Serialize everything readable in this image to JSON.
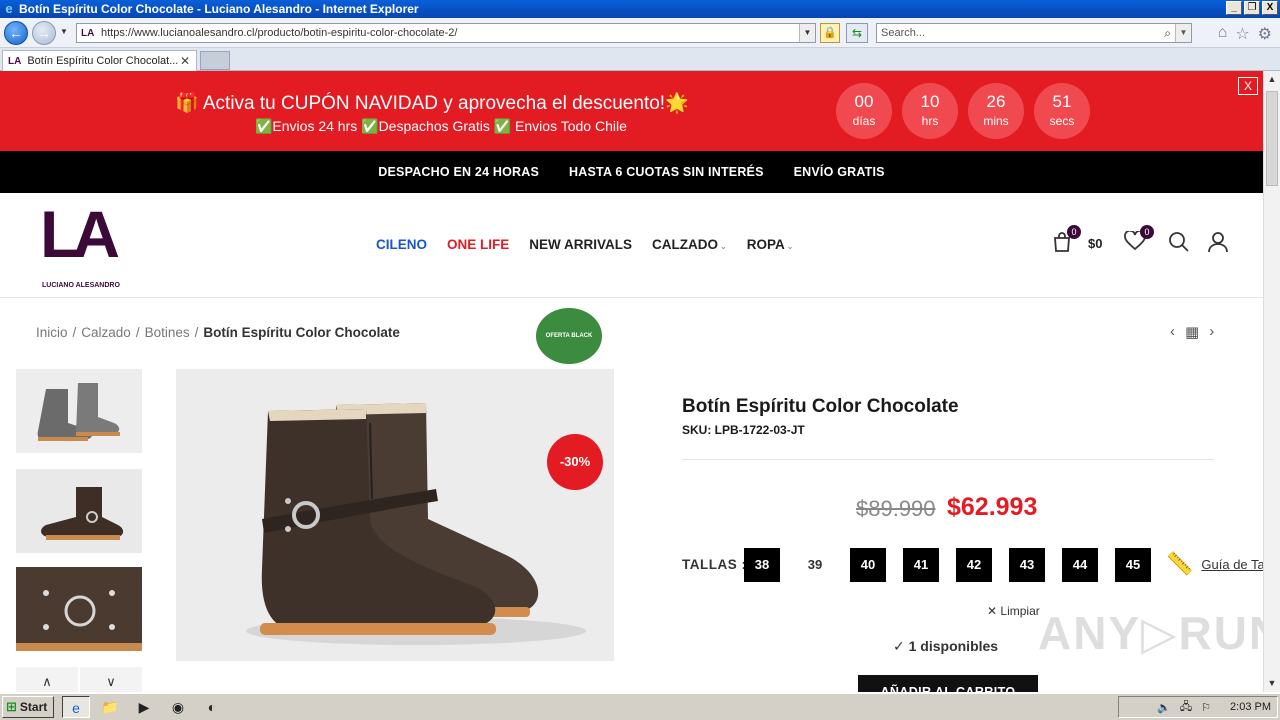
{
  "window": {
    "title": "Botín Espíritu Color Chocolate - Luciano Alesandro - Internet Explorer",
    "minimize": "_",
    "restore": "❐",
    "close": "X"
  },
  "addressbar": {
    "url": "https://www.lucianoalesandro.cl/producto/botin-espiritu-color-chocolate-2/",
    "search_placeholder": "Search...",
    "site_icon": "LA"
  },
  "tabs": [
    {
      "label": "Botín Espíritu Color Chocolat...",
      "icon": "LA"
    }
  ],
  "promo": {
    "headline": "🎁 Activa tu CUPÓN NAVIDAD y aprovecha el descuento!🌟",
    "subline": "✅Envios 24 hrs ✅Despachos Gratis ✅ Envios Todo Chile",
    "countdown": [
      {
        "value": "00",
        "unit": "días"
      },
      {
        "value": "10",
        "unit": "hrs"
      },
      {
        "value": "26",
        "unit": "mins"
      },
      {
        "value": "51",
        "unit": "secs"
      }
    ],
    "close_label": "X"
  },
  "strip": [
    "DESPACHO EN 24 HORAS",
    "HASTA 6 CUOTAS SIN INTERÉS",
    "ENVÍO GRATIS"
  ],
  "brand": {
    "mark": "LA",
    "name": "LUCIANO ALESANDRO"
  },
  "nav": [
    {
      "label": "CILENO",
      "style": "blue",
      "has_menu": false
    },
    {
      "label": "ONE LIFE",
      "style": "red",
      "has_menu": false
    },
    {
      "label": "NEW ARRIVALS",
      "style": "",
      "has_menu": false
    },
    {
      "label": "CALZADO",
      "style": "",
      "has_menu": true
    },
    {
      "label": "ROPA",
      "style": "",
      "has_menu": true
    }
  ],
  "header_icons": {
    "cart_count": "0",
    "cart_total": "$0",
    "wishlist_count": "0"
  },
  "breadcrumb": {
    "items": [
      "Inicio",
      "Calzado",
      "Botines"
    ],
    "separator": "/",
    "current": "Botín Espíritu Color Chocolate"
  },
  "product": {
    "badge_oferta": "OFERTA BLACK",
    "badge_discount": "-30%",
    "title": "Botín Espíritu Color Chocolate",
    "sku": "SKU: LPB-1722-03-JT",
    "price_old": "$89.990",
    "price_new": "$62.993",
    "sizes_label": "TALLAS :",
    "sizes": [
      {
        "label": "38",
        "available": true
      },
      {
        "label": "39",
        "available": false
      },
      {
        "label": "40",
        "available": true
      },
      {
        "label": "41",
        "available": true
      },
      {
        "label": "42",
        "available": true
      },
      {
        "label": "43",
        "available": true
      },
      {
        "label": "44",
        "available": true
      },
      {
        "label": "45",
        "available": true
      }
    ],
    "size_guide": "Guía de Ta",
    "clear": "✕ Limpiar",
    "stock": "1 disponibles",
    "add_to_cart": "AÑADIR AL CARRITO"
  },
  "watermark": "ANY▷RUN",
  "taskbar": {
    "start": "Start",
    "clock": "2:03 PM"
  },
  "colors": {
    "accent_red": "#e31b23",
    "brand_purple": "#3b0a39",
    "oferta_green": "#3b8c3e"
  }
}
